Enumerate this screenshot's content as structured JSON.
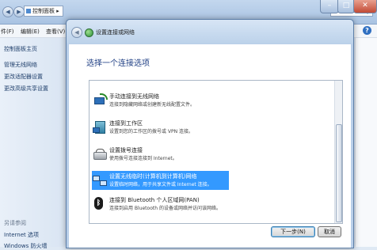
{
  "background_window": {
    "address": "控制面板 ▸",
    "menu": [
      "件(F)",
      "编辑(E)",
      "查看(V)"
    ],
    "help": "?",
    "sidebar": {
      "home": "控制面板主页",
      "links": [
        "管理无线网络",
        "更改适配器设置",
        "更改高级共享设置"
      ],
      "see_also_label": "另请参阅",
      "see_also_links": [
        "Internet 选项",
        "Windows 防火墙"
      ]
    }
  },
  "dialog": {
    "title": "设置连接或网络",
    "heading": "选择一个连接选项",
    "options": [
      {
        "title": "手动连接到无线网络",
        "desc": "连接到隐藏网络或创建新无线配置文件。",
        "icon": "wireless-network-icon",
        "selected": false
      },
      {
        "title": "连接到工作区",
        "desc": "设置到您的工作区的拨号或 VPN 连接。",
        "icon": "workplace-icon",
        "selected": false
      },
      {
        "title": "设置拨号连接",
        "desc": "使用拨号连接连接到 Internet。",
        "icon": "dialup-modem-icon",
        "selected": false
      },
      {
        "title": "设置无线临时(计算机到计算机)网络",
        "desc": "设置临时网络，用于共享文件或 Internet 连接。",
        "icon": "adhoc-network-icon",
        "selected": true
      },
      {
        "title": "连接到 Bluetooth 个人区域网(PAN)",
        "desc": "连接到启用 Bluetooth 的设备或网络并访问该网络。",
        "icon": "bluetooth-icon",
        "selected": false
      }
    ],
    "buttons": {
      "next": "下一步(N)",
      "cancel": "取消"
    }
  },
  "colors": {
    "selection": "#3399ff",
    "heading": "#1f3f84",
    "link": "#1f3f6b"
  }
}
